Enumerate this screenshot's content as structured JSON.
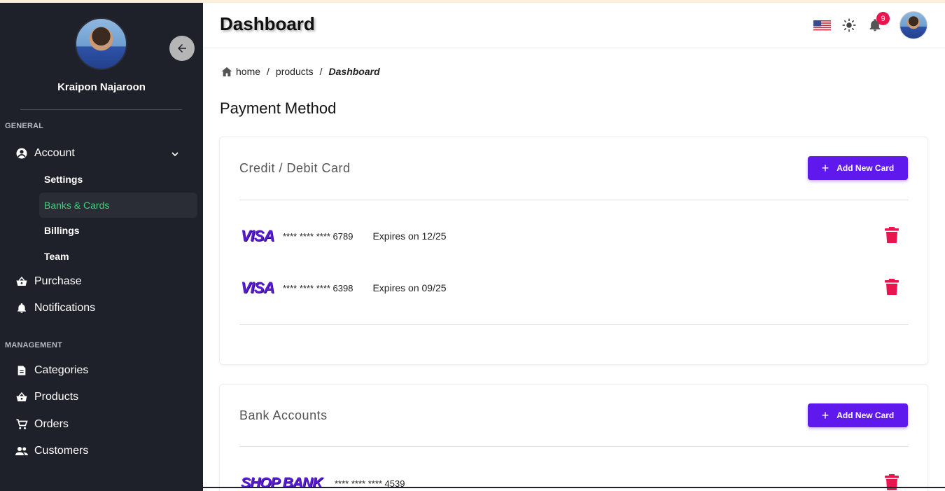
{
  "sidebar": {
    "user_name": "Kraipon Najaroon",
    "sections": {
      "general": "GENERAL",
      "management": "MANAGEMENT"
    },
    "account": {
      "label": "Account",
      "sub_items": [
        "Settings",
        "Banks & Cards",
        "Billings",
        "Team"
      ],
      "active": "Banks & Cards"
    },
    "purchase": "Purchase",
    "notifications": "Notifications",
    "categories": "Categories",
    "products": "Products",
    "orders": "Orders",
    "customers": "Customers"
  },
  "header": {
    "title": "Dashboard",
    "notification_count": "9"
  },
  "breadcrumb": {
    "home": "home",
    "products": "products",
    "current": "Dashboard",
    "separator": "/"
  },
  "page": {
    "section_title": "Payment Method"
  },
  "credit_cards": {
    "title": "Credit / Debit Card",
    "add_button": "Add New Card",
    "cards": [
      {
        "brand": "VISA",
        "number": "**** **** **** 6789",
        "expiry": "Expires on 12/25"
      },
      {
        "brand": "VISA",
        "number": "**** **** **** 6398",
        "expiry": "Expires on 09/25"
      }
    ]
  },
  "bank_accounts": {
    "title": "Bank Accounts",
    "add_button": "Add New Card",
    "accounts": [
      {
        "brand": "SHOP BANK",
        "number": "**** **** **** 4539"
      }
    ]
  },
  "colors": {
    "sidebar_bg": "#1e212a",
    "accent": "#6019ec",
    "active_green": "#3dd17a",
    "danger": "#e8154f"
  }
}
